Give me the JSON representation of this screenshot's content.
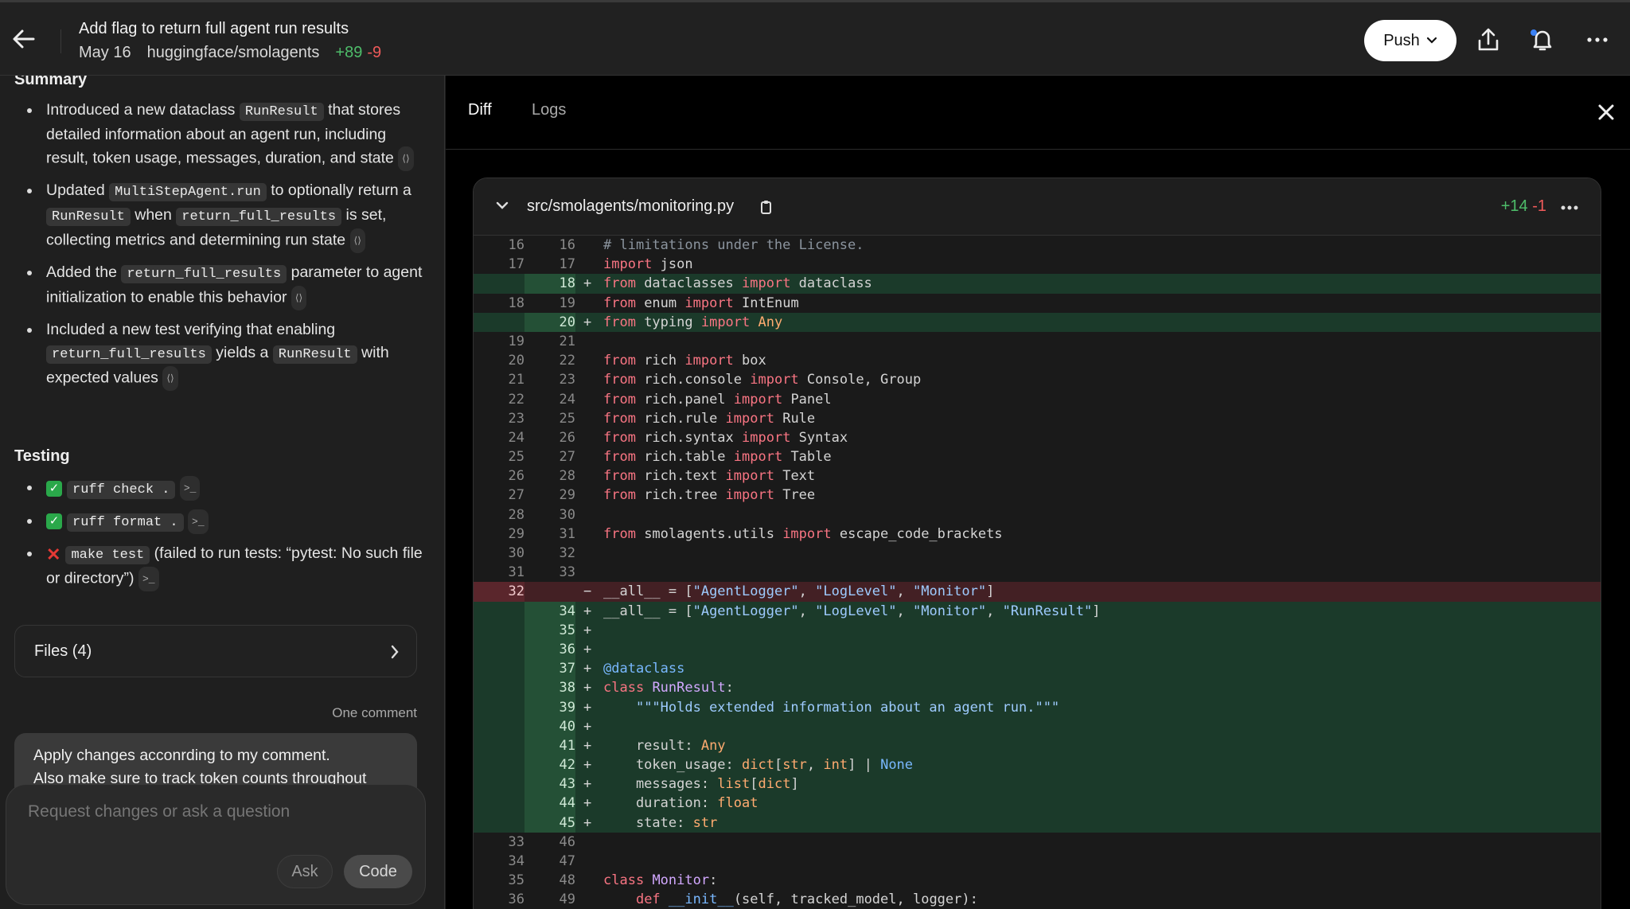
{
  "header": {
    "title": "Add flag to return full agent run results",
    "date": "May 16",
    "repo": "huggingface/smolagents",
    "additions": "+89",
    "deletions": "-9",
    "push_label": "Push"
  },
  "summary": {
    "heading": "Summary",
    "items": [
      {
        "a": "Introduced a new dataclass ",
        "code1": "RunResult",
        "b": " that stores detailed information about an agent run, including result, token usage, messages, duration, and state"
      },
      {
        "a": "Updated ",
        "code1": "MultiStepAgent.run",
        "b": " to optionally return a ",
        "code2": "RunResult",
        "c": " when ",
        "code3": "return_full_results",
        "d": " is set, collecting metrics and determining run state"
      },
      {
        "a": "Added the ",
        "code1": "return_full_results",
        "b": " parameter to agent initialization to enable this behavior"
      },
      {
        "a": "Included a new test verifying that enabling ",
        "code1": "return_full_results",
        "b": " yields a ",
        "code2": "RunResult",
        "c": " with expected values"
      }
    ]
  },
  "testing": {
    "heading": "Testing",
    "items": [
      {
        "status": "pass",
        "code": "ruff check .",
        "text": ""
      },
      {
        "status": "pass",
        "code": "ruff format .",
        "text": ""
      },
      {
        "status": "fail",
        "code": "make test",
        "text": " (failed to run tests: “pytest: No such file or directory”)"
      }
    ]
  },
  "files_button": "Files (4)",
  "comment_count": "One comment",
  "comment_text": "Apply changes acconrding to my comment.\nAlso make sure to track token counts throughout",
  "composer": {
    "placeholder": "Request changes or ask a question",
    "ask": "Ask",
    "code": "Code"
  },
  "tabs": [
    {
      "label": "Diff"
    },
    {
      "label": "Logs"
    }
  ],
  "diff_file": {
    "path": "src/smolagents/monitoring.py",
    "additions": "+14",
    "deletions": "-1"
  },
  "diff_lines": [
    {
      "o": "16",
      "n": "16",
      "t": "ctx",
      "h": "<span class=\"cm\"># limitations under the License.</span>"
    },
    {
      "o": "17",
      "n": "17",
      "t": "ctx",
      "h": "<span class=\"kw\">import</span> json"
    },
    {
      "o": "",
      "n": "18",
      "t": "add",
      "h": "<span class=\"kw\">from</span> dataclasses <span class=\"kw\">import</span> dataclass"
    },
    {
      "o": "18",
      "n": "19",
      "t": "ctx",
      "h": "<span class=\"kw\">from</span> enum <span class=\"kw\">import</span> IntEnum"
    },
    {
      "o": "",
      "n": "20",
      "t": "add",
      "h": "<span class=\"kw\">from</span> typing <span class=\"kw\">import</span> <span class=\"ty\">Any</span>"
    },
    {
      "o": "19",
      "n": "21",
      "t": "ctx",
      "h": ""
    },
    {
      "o": "20",
      "n": "22",
      "t": "ctx",
      "h": "<span class=\"kw\">from</span> rich <span class=\"kw\">import</span> box"
    },
    {
      "o": "21",
      "n": "23",
      "t": "ctx",
      "h": "<span class=\"kw\">from</span> rich.console <span class=\"kw\">import</span> Console, Group"
    },
    {
      "o": "22",
      "n": "24",
      "t": "ctx",
      "h": "<span class=\"kw\">from</span> rich.panel <span class=\"kw\">import</span> Panel"
    },
    {
      "o": "23",
      "n": "25",
      "t": "ctx",
      "h": "<span class=\"kw\">from</span> rich.rule <span class=\"kw\">import</span> Rule"
    },
    {
      "o": "24",
      "n": "26",
      "t": "ctx",
      "h": "<span class=\"kw\">from</span> rich.syntax <span class=\"kw\">import</span> Syntax"
    },
    {
      "o": "25",
      "n": "27",
      "t": "ctx",
      "h": "<span class=\"kw\">from</span> rich.table <span class=\"kw\">import</span> Table"
    },
    {
      "o": "26",
      "n": "28",
      "t": "ctx",
      "h": "<span class=\"kw\">from</span> rich.text <span class=\"kw\">import</span> Text"
    },
    {
      "o": "27",
      "n": "29",
      "t": "ctx",
      "h": "<span class=\"kw\">from</span> rich.tree <span class=\"kw\">import</span> Tree"
    },
    {
      "o": "28",
      "n": "30",
      "t": "ctx",
      "h": ""
    },
    {
      "o": "29",
      "n": "31",
      "t": "ctx",
      "h": "<span class=\"kw\">from</span> smolagents.utils <span class=\"kw\">import</span> escape_code_brackets"
    },
    {
      "o": "30",
      "n": "32",
      "t": "ctx",
      "h": ""
    },
    {
      "o": "31",
      "n": "33",
      "t": "ctx",
      "h": ""
    },
    {
      "o": "32",
      "n": "",
      "t": "del",
      "h": "__all__ = [<span class=\"st\">\"AgentLogger\"</span>, <span class=\"st\">\"LogLevel\"</span>, <span class=\"st\">\"Monitor\"</span>]"
    },
    {
      "o": "",
      "n": "34",
      "t": "add",
      "h": "__all__ = [<span class=\"st\">\"AgentLogger\"</span>, <span class=\"st\">\"LogLevel\"</span>, <span class=\"st\">\"Monitor\"</span>, <span class=\"st\">\"RunResult\"</span>]"
    },
    {
      "o": "",
      "n": "35",
      "t": "add",
      "h": ""
    },
    {
      "o": "",
      "n": "36",
      "t": "add",
      "h": ""
    },
    {
      "o": "",
      "n": "37",
      "t": "add",
      "h": "<span class=\"dec\">@dataclass</span>"
    },
    {
      "o": "",
      "n": "38",
      "t": "add",
      "h": "<span class=\"kw\">class</span> <span class=\"cls\">RunResult</span>:"
    },
    {
      "o": "",
      "n": "39",
      "t": "add",
      "h": "    <span class=\"st\">\"\"\"Holds extended information about an agent run.\"\"\"</span>"
    },
    {
      "o": "",
      "n": "40",
      "t": "add",
      "h": ""
    },
    {
      "o": "",
      "n": "41",
      "t": "add",
      "h": "    result: <span class=\"ty\">Any</span>"
    },
    {
      "o": "",
      "n": "42",
      "t": "add",
      "h": "    token_usage: <span class=\"ty\">dict</span>[<span class=\"ty\">str</span>, <span class=\"ty\">int</span>] | <span class=\"nn\">None</span>"
    },
    {
      "o": "",
      "n": "43",
      "t": "add",
      "h": "    messages: <span class=\"ty\">list</span>[<span class=\"ty\">dict</span>]"
    },
    {
      "o": "",
      "n": "44",
      "t": "add",
      "h": "    duration: <span class=\"ty\">float</span>"
    },
    {
      "o": "",
      "n": "45",
      "t": "add",
      "h": "    state: <span class=\"ty\">str</span>"
    },
    {
      "o": "33",
      "n": "46",
      "t": "ctx",
      "h": ""
    },
    {
      "o": "34",
      "n": "47",
      "t": "ctx",
      "h": ""
    },
    {
      "o": "35",
      "n": "48",
      "t": "ctx",
      "h": "<span class=\"kw\">class</span> <span class=\"cls\">Monitor</span>:"
    },
    {
      "o": "36",
      "n": "49",
      "t": "ctx",
      "h": "    <span class=\"kw\">def</span> <span class=\"nn\">__init__</span>(self, tracked_model, logger):"
    }
  ],
  "colors": {
    "accent_add": "#4ebd6a",
    "accent_del": "#ef5a5a"
  },
  "icons": [
    "arrow-left-icon",
    "chevron-down-icon",
    "share-icon",
    "bell-icon",
    "more-icon",
    "close-icon",
    "copy-icon",
    "chevron-right-icon"
  ]
}
